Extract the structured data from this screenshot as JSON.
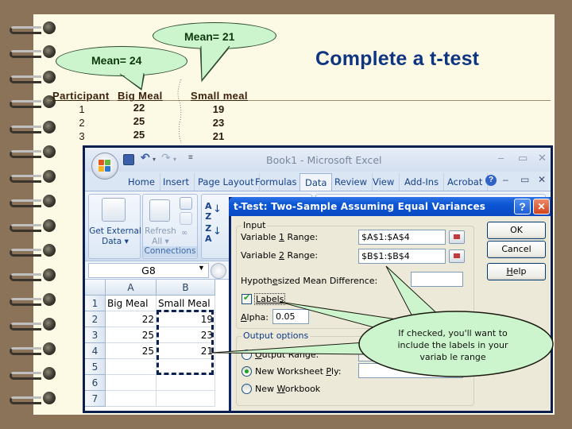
{
  "slide": {
    "title": "Complete a t-test",
    "bubbles": {
      "big_meal_mean": "Mean= 24",
      "small_meal_mean": "Mean= 21"
    },
    "table": {
      "headers": [
        "Participant",
        "Big Meal",
        "Small meal"
      ],
      "rows": [
        {
          "participant": "1",
          "big_meal": "22",
          "small_meal": "19"
        },
        {
          "participant": "2",
          "big_meal": "25",
          "small_meal": "23"
        },
        {
          "participant": "3",
          "big_meal": "25",
          "small_meal": "21"
        }
      ]
    },
    "callout": {
      "line1": "If checked, you'll want to",
      "line2": "include the labels in your",
      "line3": "variab le range"
    }
  },
  "excel": {
    "title": "Book1 - Microsoft Excel",
    "tabs": [
      "Home",
      "Insert",
      "Page Layout",
      "Formulas",
      "Data",
      "Review",
      "View",
      "Add-Ins",
      "Acrobat"
    ],
    "active_tab": "Data",
    "ribbon": {
      "get_external_data_1": "Get External",
      "get_external_data_2": "Data ▾",
      "refresh_1": "Refresh",
      "refresh_2": "All ▾",
      "connections_group": "Connections",
      "sort_az": "A↓Z",
      "sort_za": "Z↓A"
    },
    "name_box": "G8",
    "columns": [
      "A",
      "B"
    ],
    "rows": [
      {
        "n": "1",
        "a": "Big Meal",
        "b": "Small Meal"
      },
      {
        "n": "2",
        "a": "22",
        "b": "19"
      },
      {
        "n": "3",
        "a": "25",
        "b": "23"
      },
      {
        "n": "4",
        "a": "25",
        "b": "21"
      },
      {
        "n": "5",
        "a": "",
        "b": ""
      },
      {
        "n": "6",
        "a": "",
        "b": ""
      },
      {
        "n": "7",
        "a": "",
        "b": ""
      }
    ],
    "window_controls": {
      "minimize": "–",
      "restore": "▭",
      "close": "✕",
      "help": "?"
    }
  },
  "dialog": {
    "title": "t-Test: Two-Sample Assuming Equal Variances",
    "help_glyph": "?",
    "close_glyph": "✕",
    "input_group": "Input",
    "var1_label_pre": "Variable ",
    "var1_label_key": "1",
    "var1_label_post": " Range:",
    "var1_value": "$A$1:$A$4",
    "var2_label_pre": "Variable ",
    "var2_label_key": "2",
    "var2_label_post": " Range:",
    "var2_value": "$B$1:$B$4",
    "hyp_label_pre": "Hypoth",
    "hyp_label_key": "e",
    "hyp_label_post": "sized Mean Difference:",
    "hyp_value": "",
    "labels_label": "Labels",
    "labels_checked": true,
    "alpha_label_key": "A",
    "alpha_label_post": "lpha:",
    "alpha_value": "0.05",
    "output_group": "Output options",
    "output_range_key": "O",
    "output_range_post": "utput Range:",
    "output_range_value": "",
    "new_ws_pre": "New Worksheet ",
    "new_ws_key": "P",
    "new_ws_post": "ly:",
    "new_ws_value": "",
    "new_wb_pre": "New ",
    "new_wb_key": "W",
    "new_wb_post": "orkbook",
    "selected_output": "New Worksheet Ply",
    "ok": "OK",
    "cancel": "Cancel",
    "help_key": "H",
    "help_post": "elp"
  }
}
